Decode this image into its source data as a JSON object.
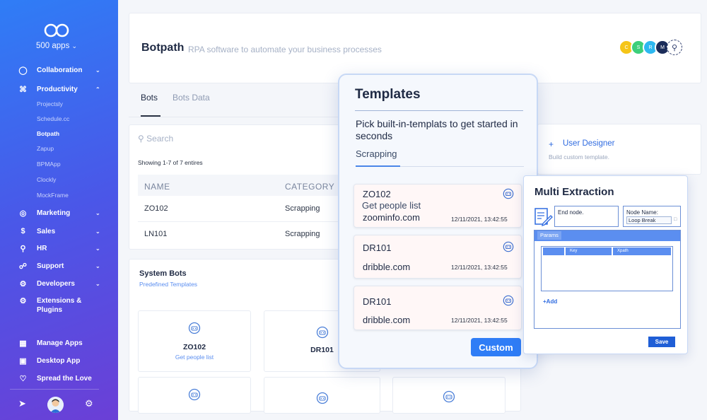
{
  "sidebar": {
    "apps_count": "500 apps",
    "items": [
      {
        "label": "Collaboration"
      },
      {
        "label": "Productivity"
      },
      {
        "label": "Marketing"
      },
      {
        "label": "Sales"
      },
      {
        "label": "HR"
      },
      {
        "label": "Support"
      },
      {
        "label": "Developers"
      },
      {
        "label": "Extensions &"
      },
      {
        "label": "Plugins"
      }
    ],
    "subitems": [
      "Projectsly",
      "Schedule.cc",
      "Botpath",
      "Zapup",
      "BPMApp",
      "Clockly",
      "MockFrame"
    ],
    "footer": [
      "Manage Apps",
      "Desktop App",
      "Spread the Love"
    ]
  },
  "header": {
    "brand": "Botpath",
    "tagline": "RPA software to automate your business processes",
    "avatars": [
      "C",
      "S",
      "R",
      "M"
    ]
  },
  "tabs": [
    "Bots",
    "Bots Data"
  ],
  "table": {
    "search_placeholder": "Search",
    "showing": "Showing 1-7 of 7 entires",
    "columns": [
      "NAME",
      "CATEGORY"
    ],
    "rows": [
      {
        "name": "ZO102",
        "category": "Scrapping"
      },
      {
        "name": "LN101",
        "category": "Scrapping"
      }
    ]
  },
  "system_bots": {
    "title": "System Bots",
    "subtitle": "Predefined Templates",
    "bots": [
      {
        "name": "ZO102",
        "desc": "Get people list"
      },
      {
        "name": "DR101",
        "desc": ""
      }
    ]
  },
  "user_designer": {
    "plus": "+",
    "title": "User Designer",
    "subtitle": "Build custom template."
  },
  "templates": {
    "title": "Templates",
    "description": "Pick built-in-templats to get started in seconds",
    "tab": "Scrapping",
    "cards": [
      {
        "name": "ZO102",
        "desc": "Get people list",
        "url": "zoominfo.com",
        "time": "12/11/2021,   13:42:55"
      },
      {
        "name": "DR101",
        "desc": "",
        "url": "dribble.com",
        "time": "12/11/2021,   13:42:55"
      },
      {
        "name": "DR101",
        "desc": "",
        "url": "dribble.com",
        "time": "12/11/2021,   13:42:55"
      }
    ],
    "custom_button": "Custom"
  },
  "multi_extraction": {
    "title": "Multi Extraction",
    "end_node_label": "End node.",
    "node_name_label": "Node Name:",
    "node_name_value": "Loop Break",
    "params_label": "Params",
    "param_columns": [
      "Key",
      "Xpath"
    ],
    "add_label": "+Add",
    "save_button": "Save"
  }
}
